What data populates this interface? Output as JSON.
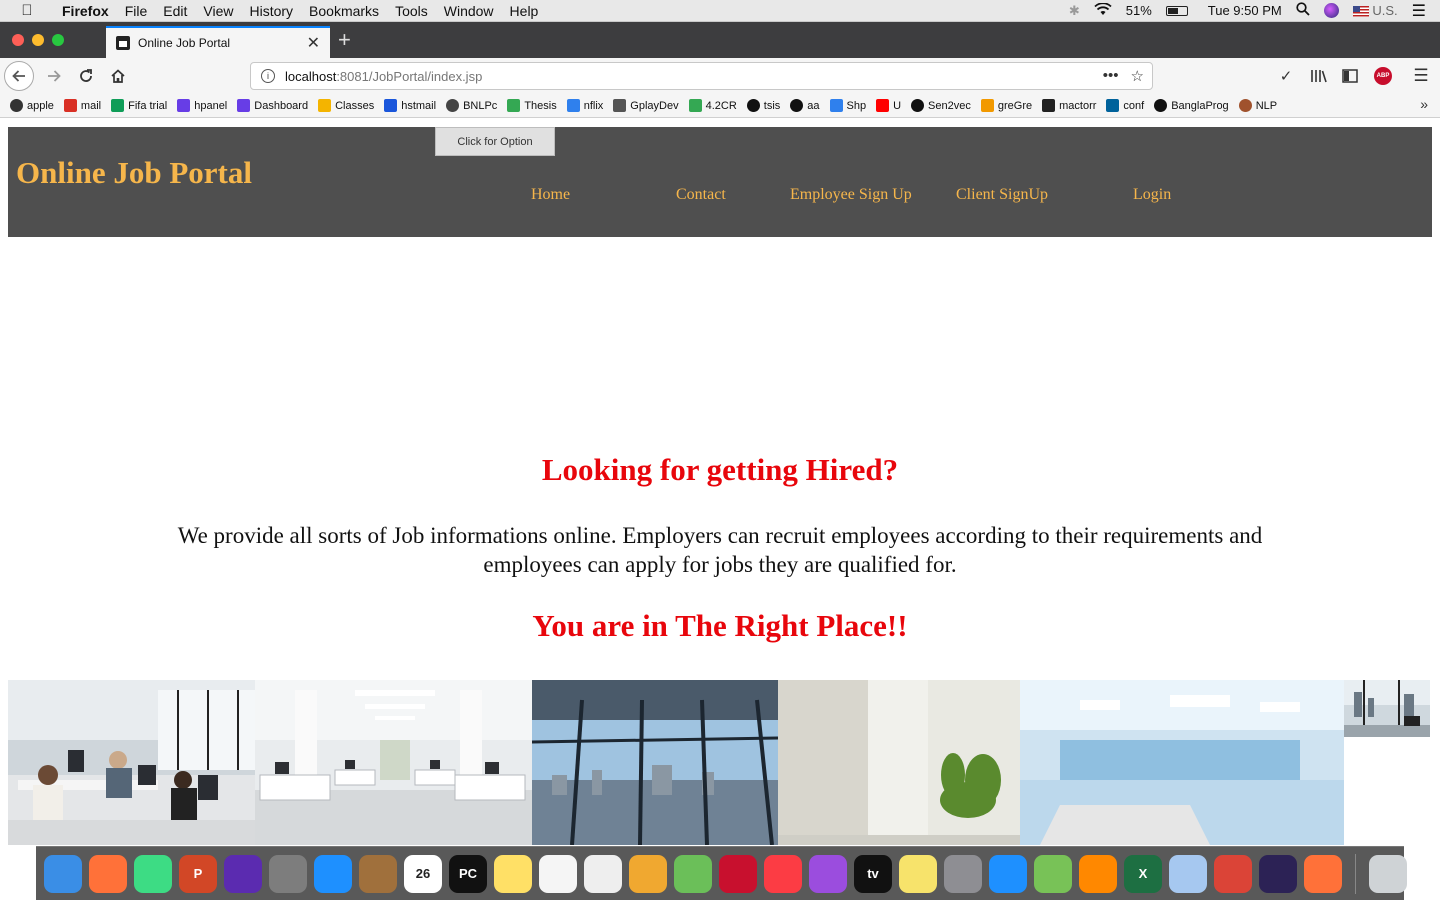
{
  "menubar": {
    "app": "Firefox",
    "items": [
      "File",
      "Edit",
      "View",
      "History",
      "Bookmarks",
      "Tools",
      "Window",
      "Help"
    ],
    "battery": "51%",
    "clock": "Tue 9:50 PM",
    "input_source": "U.S."
  },
  "browser": {
    "tab_title": "Online Job Portal",
    "url_host": "localhost",
    "url_rest": ":8081/JobPortal/index.jsp",
    "bookmarks": [
      {
        "label": "apple",
        "icon": "apple-icon",
        "color": "#333333"
      },
      {
        "label": "mail",
        "icon": "gmail-icon",
        "color": "#d93025"
      },
      {
        "label": "Fifa trial",
        "icon": "plus-icon",
        "color": "#0f9d58"
      },
      {
        "label": "hpanel",
        "icon": "hostinger-icon",
        "color": "#673de6"
      },
      {
        "label": "Dashboard",
        "icon": "hostinger-icon",
        "color": "#673de6"
      },
      {
        "label": "Classes",
        "icon": "classroom-icon",
        "color": "#f4b400"
      },
      {
        "label": "hstmail",
        "icon": "mail-icon",
        "color": "#1a56db"
      },
      {
        "label": "BNLPc",
        "icon": "globe-icon",
        "color": "#444444"
      },
      {
        "label": "Thesis",
        "icon": "drive-icon",
        "color": "#34a853"
      },
      {
        "label": "nflix",
        "icon": "s-icon",
        "color": "#2f80ed"
      },
      {
        "label": "GplayDev",
        "icon": "play-icon",
        "color": "#555555"
      },
      {
        "label": "4.2CR",
        "icon": "drive-icon",
        "color": "#34a853"
      },
      {
        "label": "tsis",
        "icon": "github-icon",
        "color": "#111111"
      },
      {
        "label": "aa",
        "icon": "github-icon",
        "color": "#111111"
      },
      {
        "label": "Shp",
        "icon": "s-icon",
        "color": "#2f80ed"
      },
      {
        "label": "U",
        "icon": "youtube-icon",
        "color": "#ff0000"
      },
      {
        "label": "Sen2vec",
        "icon": "github-icon",
        "color": "#111111"
      },
      {
        "label": "greGre",
        "icon": "orange-icon",
        "color": "#f29900"
      },
      {
        "label": "mactorr",
        "icon": "mactorr-icon",
        "color": "#222222"
      },
      {
        "label": "conf",
        "icon": "ieee-icon",
        "color": "#00629b"
      },
      {
        "label": "BanglaProg",
        "icon": "github-icon",
        "color": "#111111"
      },
      {
        "label": "NLP",
        "icon": "avatar-icon",
        "color": "#a0522d"
      }
    ]
  },
  "page": {
    "site_title": "Online Job Portal",
    "option_button": "Click for Option",
    "nav": [
      "Home",
      "Contact",
      "Employee Sign Up",
      "Client SignUp",
      "Login"
    ],
    "hero_heading": "Looking for getting Hired?",
    "hero_text": "We provide all sorts of Job informations online. Employers can recruit employees according to their requirements and employees can apply for jobs they are qualified for.",
    "hero_sub": "You are in The Right Place!!",
    "colors": {
      "header_bg": "#4f4f4f",
      "accent": "#f6b64b",
      "headline": "#e8060c"
    }
  },
  "dock": {
    "apps": [
      {
        "name": "finder-icon",
        "color": "#3a8ee6",
        "glyph": ""
      },
      {
        "name": "firefox-icon",
        "color": "#ff7139",
        "glyph": ""
      },
      {
        "name": "android-studio-icon",
        "color": "#3ddc84",
        "glyph": ""
      },
      {
        "name": "powerpoint-icon",
        "color": "#d24726",
        "glyph": "P"
      },
      {
        "name": "siri-icon",
        "color": "#5b2bb0",
        "glyph": ""
      },
      {
        "name": "launchpad-icon",
        "color": "#7d7d7d",
        "glyph": ""
      },
      {
        "name": "safari-icon",
        "color": "#1e90ff",
        "glyph": ""
      },
      {
        "name": "contacts-icon",
        "color": "#a0703c",
        "glyph": ""
      },
      {
        "name": "calendar-icon",
        "color": "#ffffff",
        "glyph": "26"
      },
      {
        "name": "pycharm-icon",
        "color": "#111111",
        "glyph": "PC"
      },
      {
        "name": "notes-icon",
        "color": "#ffe066",
        "glyph": ""
      },
      {
        "name": "reminders-icon",
        "color": "#f5f5f5",
        "glyph": ""
      },
      {
        "name": "textedit-icon",
        "color": "#eeeeee",
        "glyph": ""
      },
      {
        "name": "photos-icon",
        "color": "#f0a830",
        "glyph": ""
      },
      {
        "name": "maps-icon",
        "color": "#6bbf59",
        "glyph": ""
      },
      {
        "name": "acrobat-icon",
        "color": "#c8102e",
        "glyph": ""
      },
      {
        "name": "music-icon",
        "color": "#fc3c44",
        "glyph": ""
      },
      {
        "name": "podcasts-icon",
        "color": "#9b4dde",
        "glyph": ""
      },
      {
        "name": "apple-tv-icon",
        "color": "#111111",
        "glyph": "tv"
      },
      {
        "name": "stickies-icon",
        "color": "#f7e36b",
        "glyph": ""
      },
      {
        "name": "system-preferences-icon",
        "color": "#8e8e93",
        "glyph": ""
      },
      {
        "name": "app-store-icon",
        "color": "#1e90ff",
        "glyph": ""
      },
      {
        "name": "android-icon",
        "color": "#78c257",
        "glyph": ""
      },
      {
        "name": "vlc-icon",
        "color": "#ff8800",
        "glyph": ""
      },
      {
        "name": "excel-icon",
        "color": "#1d6f42",
        "glyph": "X"
      },
      {
        "name": "virtualbox-icon",
        "color": "#a6c8f0",
        "glyph": ""
      },
      {
        "name": "chrome-icon",
        "color": "#db4437",
        "glyph": ""
      },
      {
        "name": "eclipse-icon",
        "color": "#2c2255",
        "glyph": ""
      },
      {
        "name": "firefox-icon-2",
        "color": "#ff7139",
        "glyph": ""
      }
    ]
  }
}
